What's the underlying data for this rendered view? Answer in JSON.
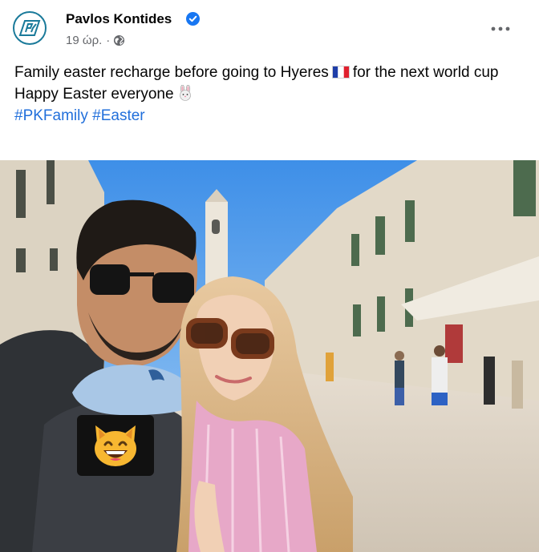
{
  "post": {
    "author": "Pavlos Kontides",
    "verified": true,
    "timestamp": "19 ώρ.",
    "separator": "·",
    "audience_icon": "globe-icon",
    "more_icon": "more-dots-icon",
    "text_line1_part1": "Family easter recharge before going to Hyeres",
    "text_line1_part2": "for the next world cup",
    "flag_icon": "france-flag-icon",
    "text_line2": "Happy Easter everyone",
    "bunny_icon": "rabbit-face-icon",
    "hashtags": [
      "#PKFamily",
      "#Easter"
    ]
  },
  "photo": {
    "sticker_icon": "grinning-cat-icon"
  },
  "colors": {
    "hashtag": "#216fdb",
    "verified_badge": "#1877f2",
    "avatar_border": "#1a7a9a",
    "meta_text": "#65676b"
  }
}
